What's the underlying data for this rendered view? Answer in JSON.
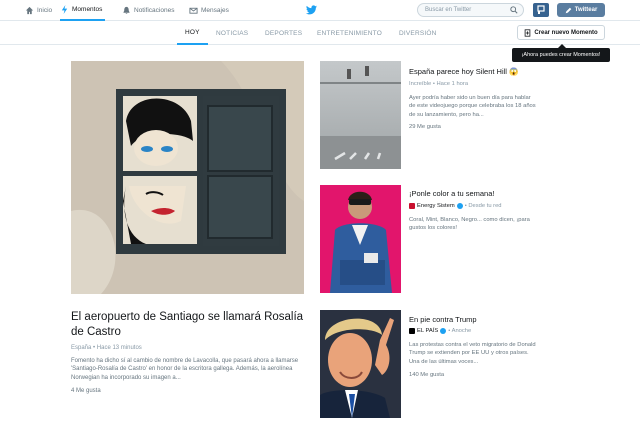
{
  "nav": {
    "home": "Inicio",
    "moments": "Momentos",
    "notifications": "Notificaciones",
    "messages": "Mensajes"
  },
  "search": {
    "placeholder": "Buscar en Twitter"
  },
  "tweet_button": "Twittear",
  "tabs": [
    {
      "label": "HOY",
      "active": true
    },
    {
      "label": "NOTICIAS",
      "active": false
    },
    {
      "label": "DEPORTES",
      "active": false
    },
    {
      "label": "ENTRETENIMIENTO",
      "active": false
    },
    {
      "label": "DIVERSIÓN",
      "active": false
    }
  ],
  "create_moment": "Crear nuevo Momento",
  "tooltip": "¡Ahora puedes crear Momentos!",
  "featured": {
    "title": "El aeropuerto de Santiago se llamará Rosalía de Castro",
    "meta": "España • Hace 13 minutos",
    "description": "Fomento ha dicho sí al cambio de nombre de Lavacolla, que pasará ahora a llamarse 'Santiago-Rosalía de Castro' en honor de la escritora gallega. Además, la aerolínea Norwegian ha incorporado su imagen a...",
    "likes": "4 Me gusta"
  },
  "cards": [
    {
      "title": "España parece hoy Silent Hill 😱",
      "meta": "Increíble • Hace 1 hora",
      "description": "Ayer podría haber sido un buen día para hablar de este videojuego porque celebraba los 18 años de su lanzamiento, pero ha...",
      "likes": "29 Me gusta"
    },
    {
      "title": "¡Ponle color a tu semana!",
      "meta": "Energy Sistem",
      "meta_suffix": "• Desde tu red",
      "description": "Coral, Mint, Blanco, Negro... como dicen, ¡para gustos los colores!",
      "likes": ""
    },
    {
      "title": "En pie contra Trump",
      "meta": "EL PAÍS",
      "meta_suffix": "• Anoche",
      "description": "Las protestas contra el veto migratorio de Donald Trump se extienden por EE UU y otros países. Una de las últimas voces...",
      "likes": "140 Me gusta"
    }
  ],
  "colors": {
    "accent": "#1da1f2",
    "tweet_button": "#5a7da0",
    "brand_energy": "#c8102e",
    "brand_elpais": "#000000"
  }
}
